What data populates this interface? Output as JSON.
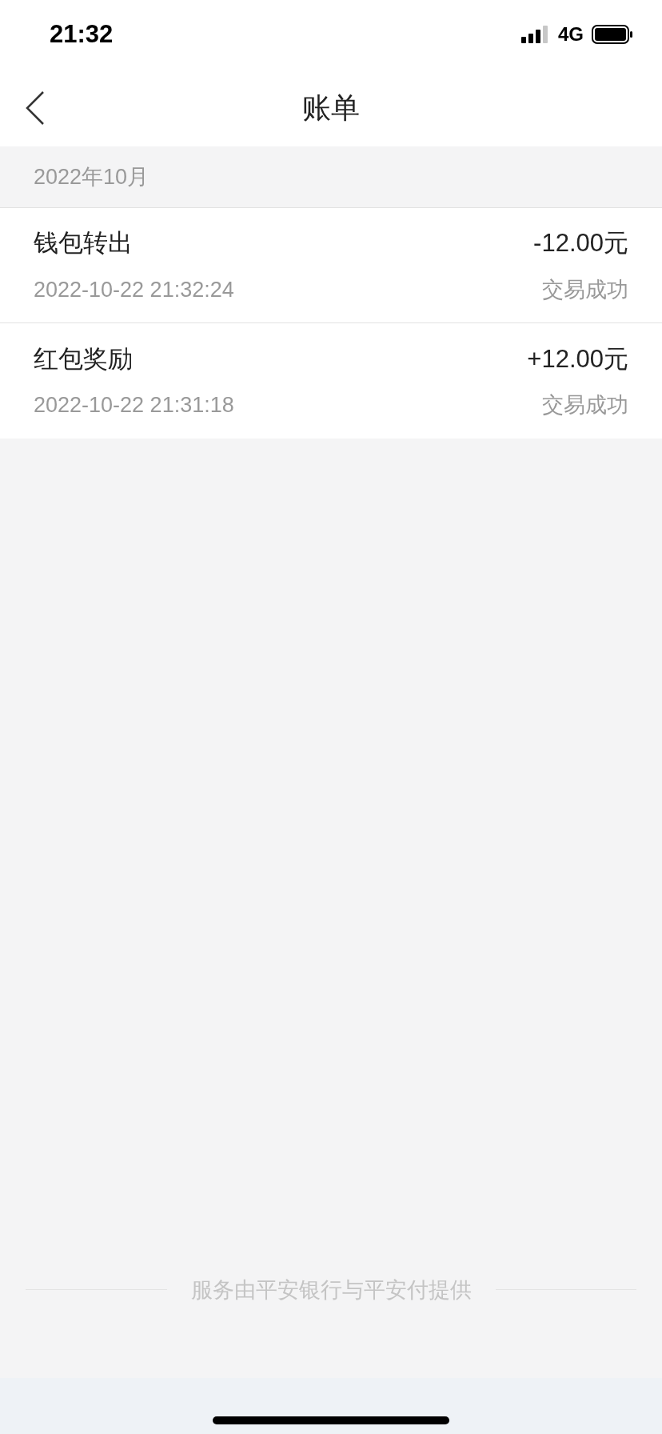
{
  "status_bar": {
    "time": "21:32",
    "network": "4G"
  },
  "nav": {
    "title": "账单"
  },
  "month": "2022年10月",
  "transactions": [
    {
      "title": "钱包转出",
      "amount": "-12.00元",
      "datetime": "2022-10-22 21:32:24",
      "status": "交易成功"
    },
    {
      "title": "红包奖励",
      "amount": "+12.00元",
      "datetime": "2022-10-22 21:31:18",
      "status": "交易成功"
    }
  ],
  "footer": "服务由平安银行与平安付提供"
}
